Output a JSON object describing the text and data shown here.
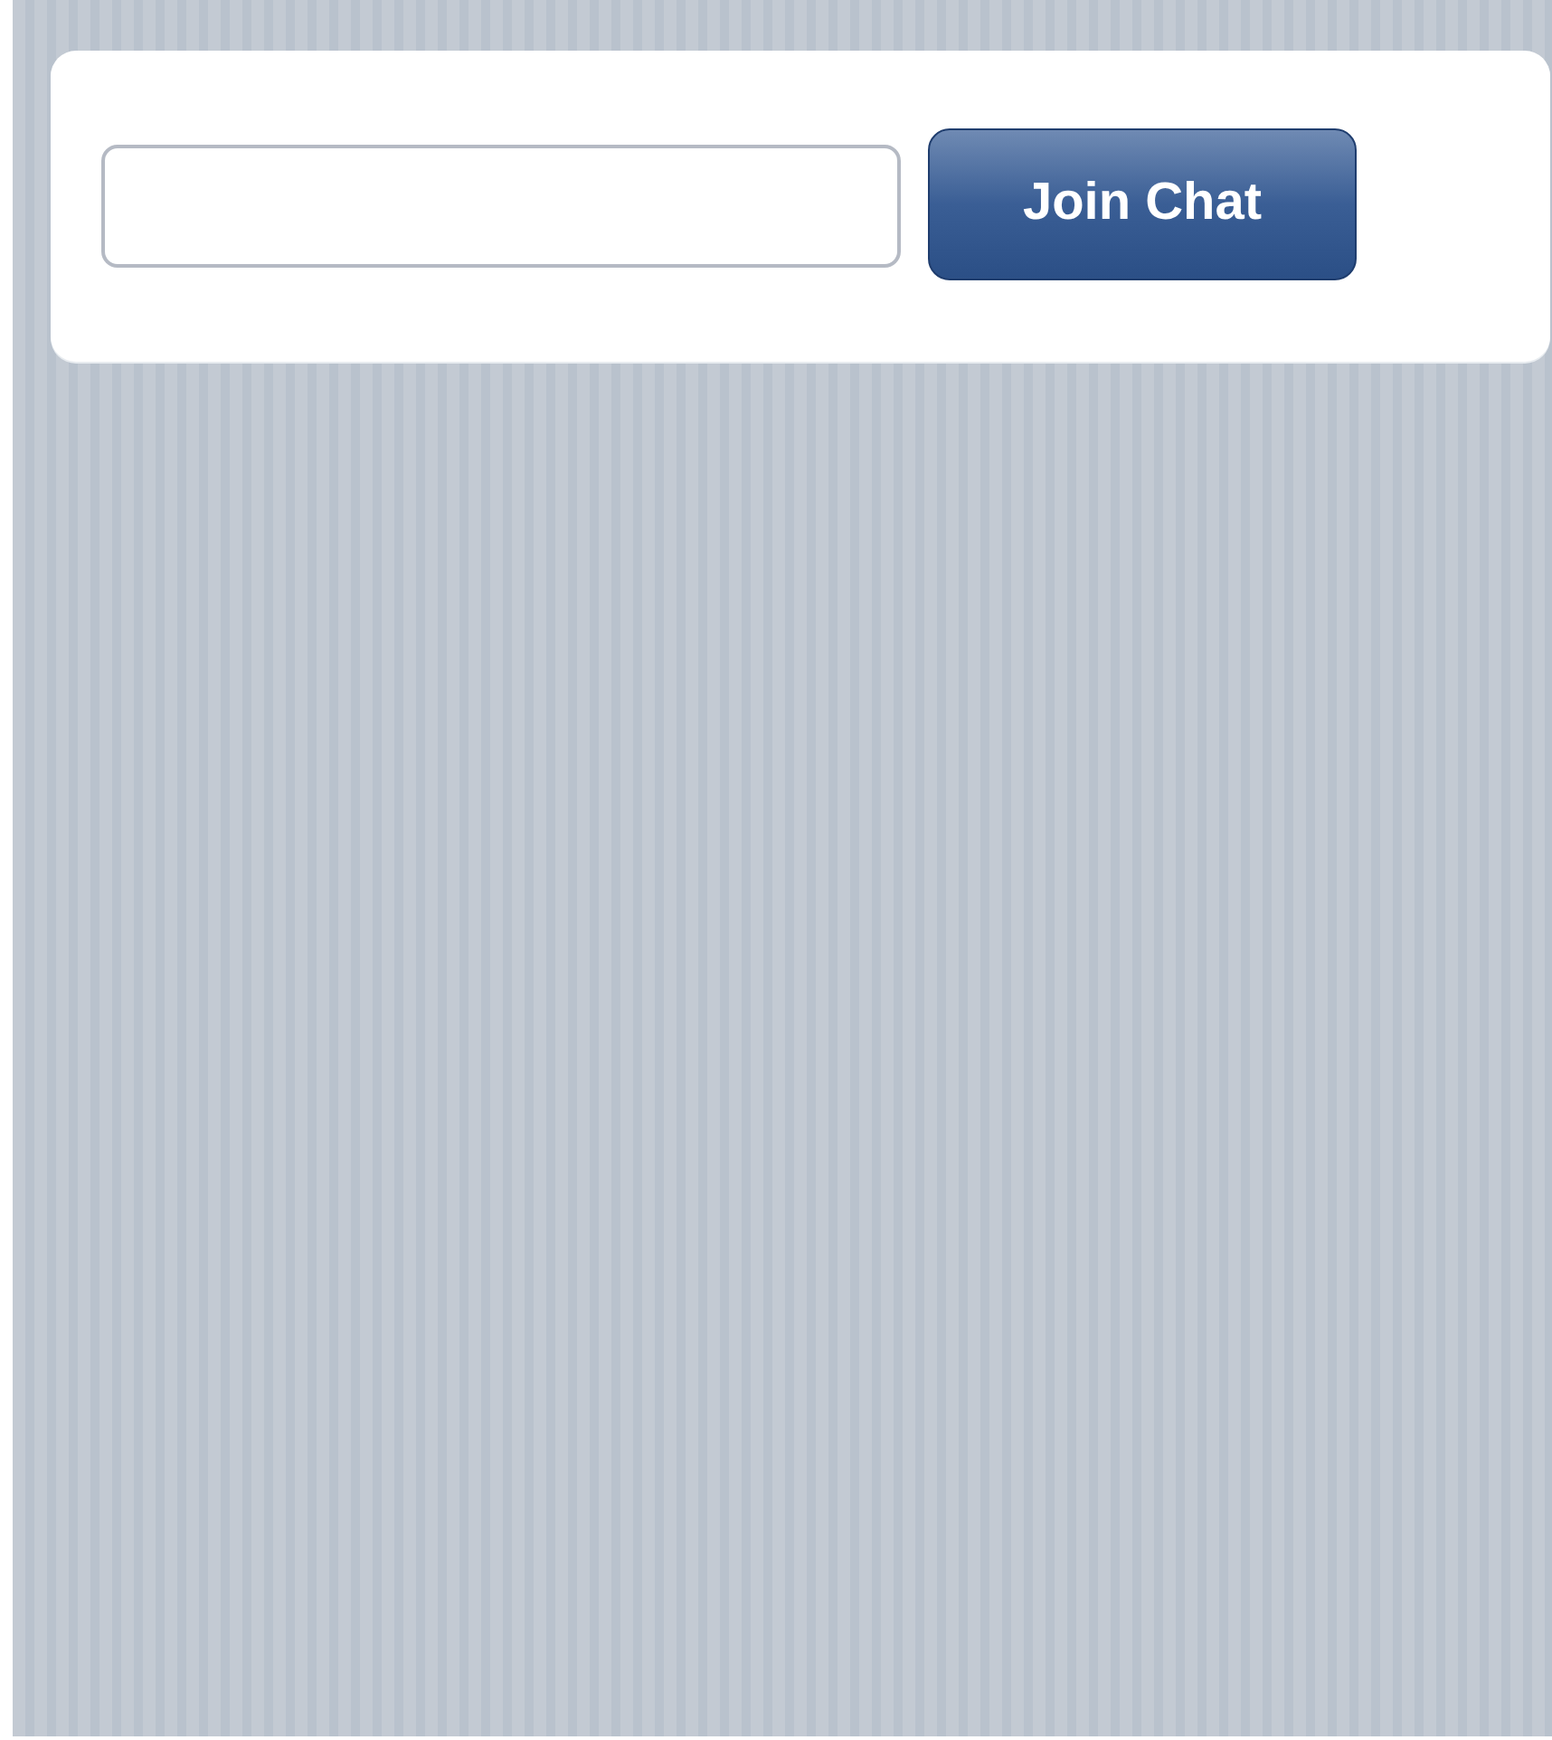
{
  "join_button": {
    "label": "Join Chat"
  }
}
